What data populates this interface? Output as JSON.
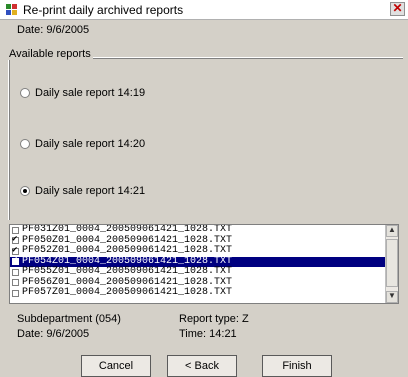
{
  "window": {
    "title": "Re-print daily archived reports",
    "close_icon": "close-icon"
  },
  "date_label": "Date: 9/6/2005",
  "group": {
    "title": "Available reports",
    "radios": [
      {
        "label": "Daily sale report 14:19",
        "selected": false
      },
      {
        "label": "Daily sale report 14:20",
        "selected": false
      },
      {
        "label": "Daily sale report 14:21",
        "selected": true
      }
    ]
  },
  "files": [
    {
      "name": "PF031Z01_0004_200509061421_1028.TXT",
      "checked": false,
      "selected": false
    },
    {
      "name": "PF050Z01_0004_200509061421_1028.TXT",
      "checked": true,
      "selected": false
    },
    {
      "name": "PF052Z01_0004_200509061421_1028.TXT",
      "checked": true,
      "selected": false
    },
    {
      "name": "PF054Z01_0004_200509061421_1028.TXT",
      "checked": true,
      "selected": true
    },
    {
      "name": "PF055Z01_0004_200509061421_1028.TXT",
      "checked": false,
      "selected": false
    },
    {
      "name": "PF056Z01_0004_200509061421_1028.TXT",
      "checked": false,
      "selected": false
    },
    {
      "name": "PF057Z01_0004_200509061421_1028.TXT",
      "checked": false,
      "selected": false
    }
  ],
  "details": {
    "subdepartment": "Subdepartment (054)",
    "date": "Date: 9/6/2005",
    "report_type": "Report type: Z",
    "time": "Time: 14:21"
  },
  "buttons": {
    "cancel": "Cancel",
    "back": "< Back",
    "finish": "Finish"
  }
}
